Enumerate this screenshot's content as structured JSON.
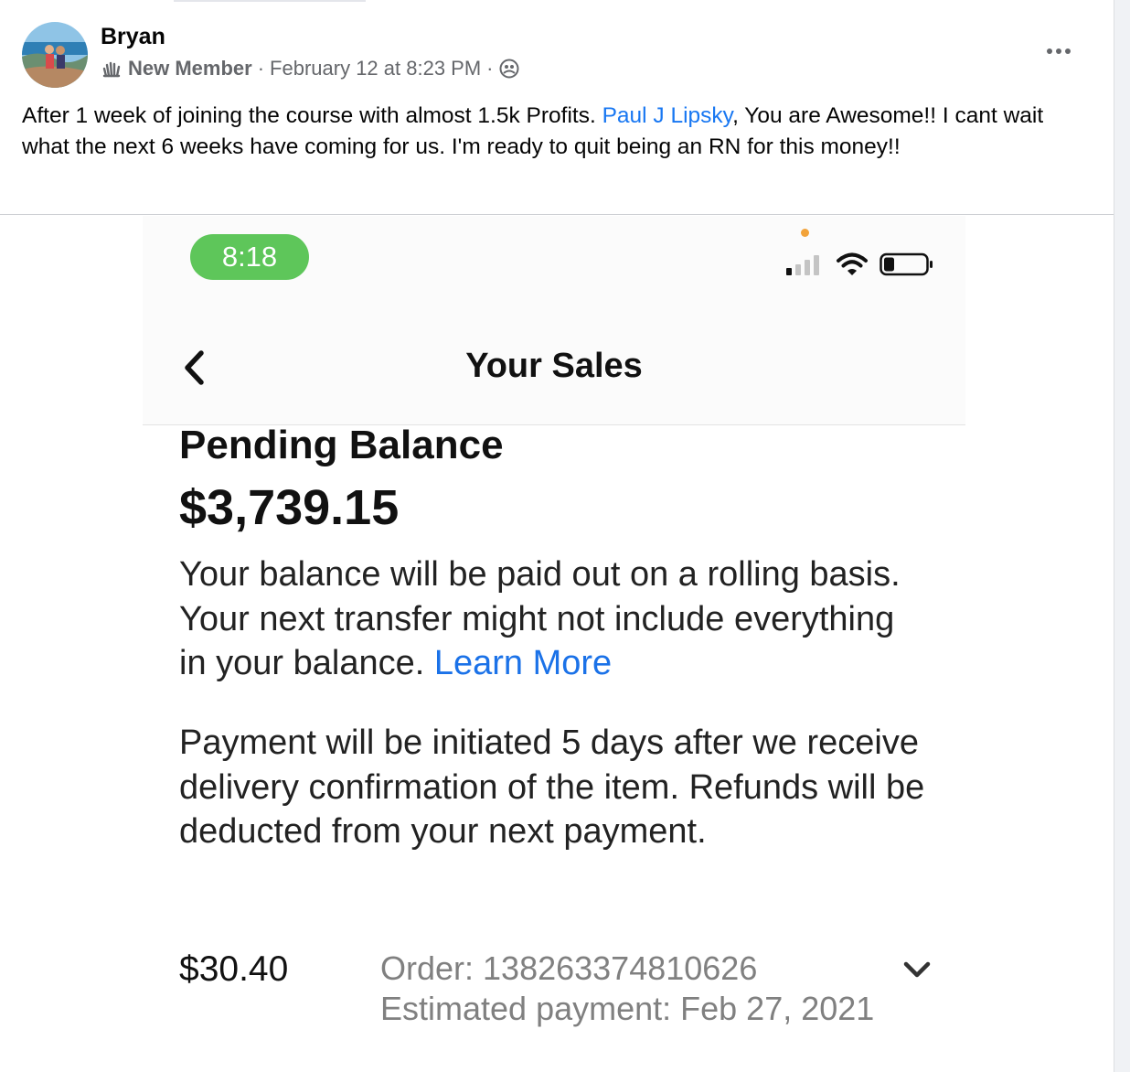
{
  "post": {
    "author": "Bryan",
    "badge": "New Member",
    "separator": "·",
    "timestamp": "February 12 at 8:23 PM",
    "text_before_mention": "After 1 week of joining the course with almost 1.5k Profits. ",
    "mention": "Paul J Lipsky",
    "text_after_mention": ", You are Awesome!! I cant wait what the next 6 weeks have coming for us. I'm ready to quit being an RN for this money!!",
    "icons": [
      "wave-hand-icon",
      "group-audience-icon",
      "more-options-icon"
    ]
  },
  "screenshot": {
    "status_time": "8:18",
    "title": "Your Sales",
    "pending_label": "Pending Balance",
    "pending_amount": "$3,739.15",
    "paragraph1": "Your balance will be paid out on a rolling basis. Your next transfer might not include everything in your balance. ",
    "learn_more": "Learn More",
    "paragraph2": "Payment will be initiated 5 days after we receive delivery confirmation of the item. Refunds will be deducted from your next payment.",
    "item": {
      "amount": "$30.40",
      "order": "Order: 138263374810626",
      "estimated": "Estimated payment: Feb 27, 2021"
    },
    "battery_level": 0.25
  },
  "colors": {
    "link": "#1877f2",
    "time_pill": "#5ec65a",
    "learn_more": "#1b72e8",
    "meta_text": "#65676b"
  }
}
